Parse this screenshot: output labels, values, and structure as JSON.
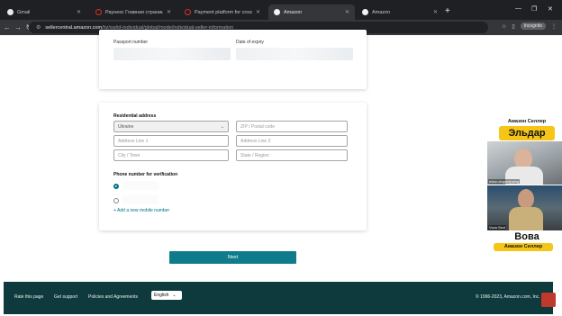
{
  "browser": {
    "tabs": [
      {
        "label": "Gmail",
        "icon_color": "#e8eaed"
      },
      {
        "label": "Раунекс Главная страница",
        "icon_color": "#d93025"
      },
      {
        "label": "Payment platform for cross-bo",
        "icon_color": "#d93025"
      },
      {
        "label": "Amazon",
        "icon_color": "#f2f2f2"
      },
      {
        "label": "Amazon",
        "icon_color": "#f2f2f2"
      }
    ],
    "new_tab": "+",
    "url_domain": "sellercentral.amazon.com",
    "url_path": "/hz/sw/id-individual/global/mode/individual-seller-information",
    "incognito_label": "Incognito"
  },
  "form": {
    "passport_number_label": "Passport number",
    "date_of_expiry_label": "Date of expiry",
    "residential_address_label": "Residential address",
    "country_value": "Ukraine",
    "zip_placeholder": "ZIP / Postal code",
    "address1_placeholder": "Address Line 1",
    "address2_placeholder": "Address Line 2",
    "city_placeholder": "City / Town",
    "state_placeholder": "State / Region",
    "phone_label": "Phone number for verification",
    "add_mobile_link": "+ Add a new mobile number",
    "next_button": "Next"
  },
  "footer": {
    "rate_page": "Rate this page",
    "get_support": "Get support",
    "policies": "Policies and Agreements",
    "language": "English",
    "copyright": "© 1996-2023, Amazon.com, Inc."
  },
  "overlay": {
    "top_tag": "Амазон Селлер",
    "top_name": "Эльдар",
    "bottom_name": "Вова",
    "bottom_tag": "Амазон Селлер",
    "cam1_caption": "eldar-dropshipping",
    "cam2_caption": "Vova Sect"
  },
  "colors": {
    "accent_teal": "#007185",
    "footer_bg": "#0f3a3d",
    "tag_yellow": "#f5c518"
  }
}
